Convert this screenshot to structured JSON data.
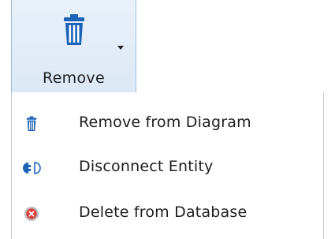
{
  "ribbon": {
    "remove_button": {
      "label": "Remove",
      "icon": "trash-icon",
      "has_dropdown": true
    }
  },
  "menu": {
    "items": [
      {
        "label": "Remove from Diagram",
        "icon": "trash-icon"
      },
      {
        "label": "Disconnect Entity",
        "icon": "disconnect-icon"
      },
      {
        "label": "Delete from Database",
        "icon": "delete-circle-icon"
      }
    ]
  },
  "colors": {
    "ribbon_border": "#9dbcdc",
    "ribbon_bg": "#dce8f5",
    "icon_blue": "#1b62b8",
    "delete_red": "#d83b3b"
  }
}
